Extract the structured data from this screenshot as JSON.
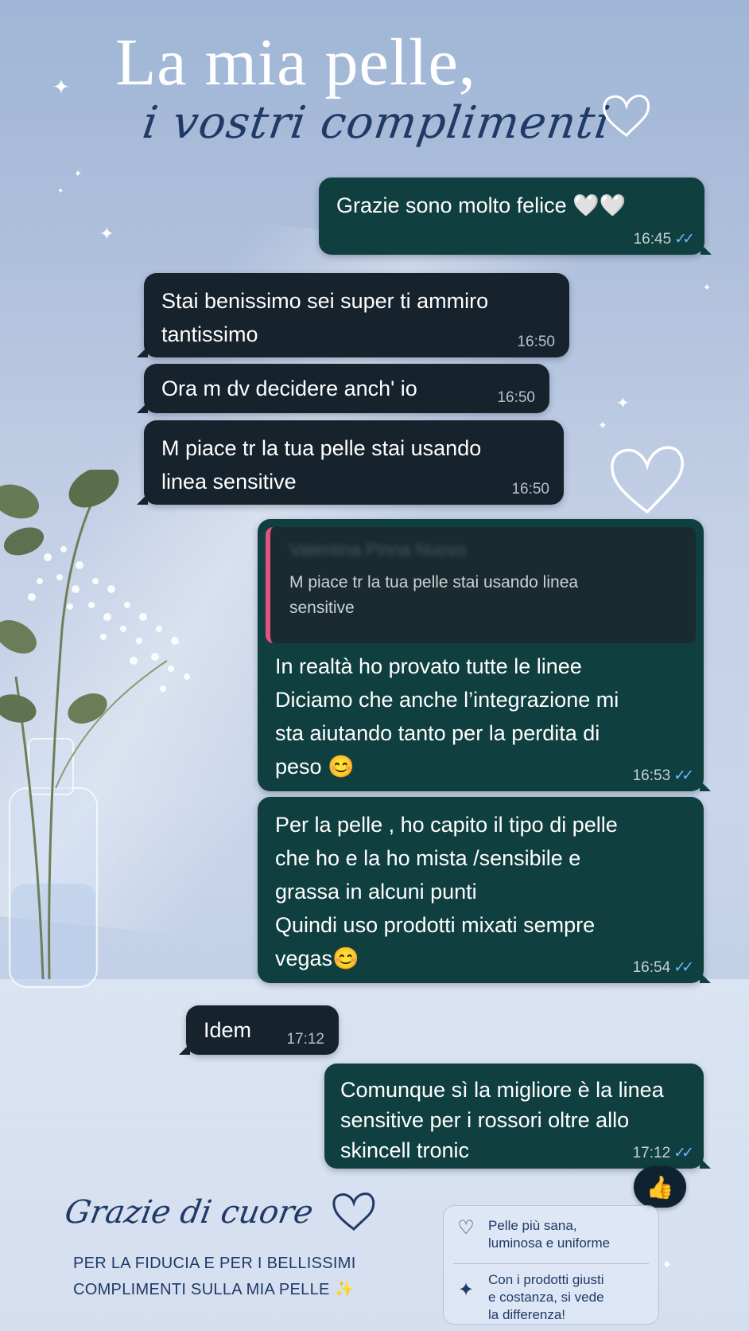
{
  "header": {
    "title_line1": "La mia pelle,",
    "title_line2": "i vostri complimenti"
  },
  "messages": [
    {
      "direction": "out",
      "text": "Grazie sono molto felice 🤍🤍",
      "time": "16:45",
      "read": true
    },
    {
      "direction": "in",
      "text": "Stai benissimo sei super ti ammiro\ntantissimo",
      "time": "16:50"
    },
    {
      "direction": "in",
      "text": "Ora m dv decidere anch' io",
      "time": "16:50"
    },
    {
      "direction": "in",
      "text": "M piace tr la tua pelle stai usando\nlinea sensitive",
      "time": "16:50"
    },
    {
      "direction": "out",
      "reply_to": {
        "name": "Valentina Pinna Nuovo",
        "text": "M piace tr la tua pelle stai usando linea\nsensitive"
      },
      "text": "In realtà ho provato tutte le linee\nDiciamo che anche l’integrazione mi\nsta aiutando tanto per la perdita di\npeso 😊",
      "time": "16:53",
      "read": true
    },
    {
      "direction": "out",
      "text": "Per la pelle , ho capito il tipo di pelle\nche ho e la ho mista /sensibile e\ngrassa in alcuni punti\nQuindi uso prodotti mixati sempre\nvegas😊",
      "time": "16:54",
      "read": true
    },
    {
      "direction": "in",
      "text": "Idem",
      "time": "17:12"
    },
    {
      "direction": "out",
      "text": "Comunque sì la migliore è la linea\nsensitive per i rossori oltre allo\nskincell tronic",
      "time": "17:12",
      "read": true,
      "reaction": "👍"
    }
  ],
  "read_ticks": "✓✓",
  "footer": {
    "thanks_title": "Grazie di cuore",
    "thanks_line1": "PER LA FIDUCIA E PER I BELLISSIMI",
    "thanks_line2": "COMPLIMENTI SULLA MIA PELLE ✨"
  },
  "card": {
    "item1": "Pelle più sana,\nluminosa e uniforme",
    "item1_icon": "heart-icon",
    "item2": "Con i prodotti giusti\ne costanza, si vede\nla differenza!",
    "item2_icon": "sparkle-icon"
  },
  "colors": {
    "outgoing_bubble": "#103f40",
    "incoming_bubble": "#16222c",
    "title_dark": "#1f3a66",
    "reply_bar": "#e3537f",
    "tick_blue": "#6cb6ff"
  }
}
